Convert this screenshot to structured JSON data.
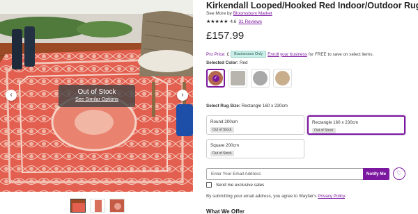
{
  "product": {
    "title": "Kirkendall Looped/Hooked Red Indoor/Outdoor Rug",
    "brand_prefix": "See More by",
    "brand": "Bloomsbury Market",
    "rating": "4.6",
    "reviews": "31 Reviews",
    "price": "£157.99"
  },
  "gallery": {
    "out_of_stock_title": "Out of Stock",
    "see_similar": "See Similar Options",
    "prev_arrow": "‹",
    "next_arrow": "›"
  },
  "pro": {
    "label": "Pro Price:",
    "currency": "£",
    "badge": "Businesses Only",
    "enroll_link": "Enroll your business",
    "enroll_rest": "for FREE to save on select items."
  },
  "color": {
    "label": "Selected Color:",
    "value": "Red",
    "swatches": [
      {
        "color": "#b4694f",
        "selected": true
      },
      {
        "color": "#b7b5ad",
        "selected": false
      },
      {
        "color": "#a9a9a9",
        "selected": false
      },
      {
        "color": "#c8ae8c",
        "selected": false
      }
    ]
  },
  "size": {
    "label": "Select Rug Size:",
    "value": "Rectangle 160 x 230cm",
    "options": [
      {
        "name": "Round 200cm",
        "status": "Out of Stock"
      },
      {
        "name": "Rectangle 160 x 230cm",
        "status": "Out of Stock"
      },
      {
        "name": "Square 200cm",
        "status": "Out of Stock"
      }
    ]
  },
  "notify": {
    "placeholder": "Enter Your Email Address",
    "button": "Notify Me",
    "heart": "♡",
    "exclusive_label": "Send me exclusive sales",
    "terms_prefix": "By submitting your email address, you agree to Wayfair's",
    "terms_link": "Privacy Policy",
    "terms_suffix": "."
  },
  "section": {
    "what_we_offer": "What We Offer"
  },
  "colors": {
    "accent": "#7b189f"
  }
}
